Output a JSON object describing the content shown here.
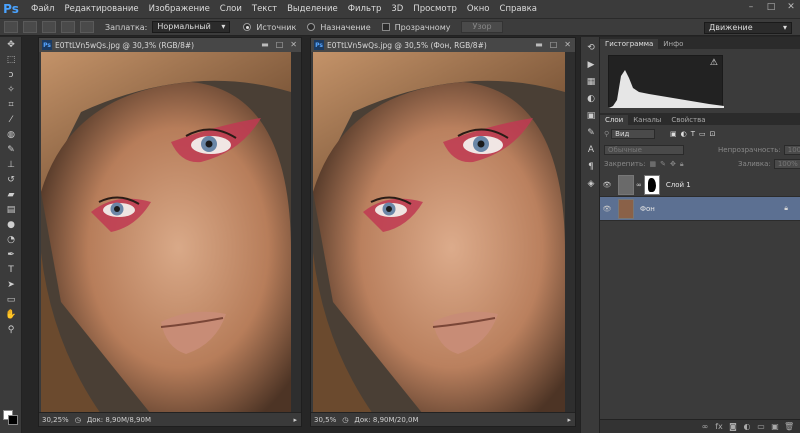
{
  "app": {
    "logo": "Ps"
  },
  "menu": [
    "Файл",
    "Редактирование",
    "Изображение",
    "Слои",
    "Текст",
    "Выделение",
    "Фильтр",
    "3D",
    "Просмотр",
    "Окно",
    "Справка"
  ],
  "options": {
    "patch_label": "Заплатка:",
    "patch_mode": "Нормальный",
    "source_label": "Источник",
    "dest_label": "Назначение",
    "transparent_label": "Прозрачному",
    "pattern_button": "Узор",
    "workspace": "Движение"
  },
  "documents": [
    {
      "title": "E0TtLVn5wQs.jpg @ 30,3% (RGB/8#)",
      "zoom": "30,25%",
      "doc_size": "Док: 8,90M/8,90M"
    },
    {
      "title": "E0TtLVn5wQs.jpg @ 30,5% (Фон, RGB/8#)",
      "zoom": "30,5%",
      "doc_size": "Док: 8,90M/20,0M"
    }
  ],
  "panels": {
    "top_tabs": [
      "Гистограмма",
      "Инфо"
    ],
    "layer_tabs": [
      "Слои",
      "Каналы",
      "Свойства"
    ],
    "kind_filter": "Вид",
    "blend_mode": "Обычные",
    "opacity_label": "Непрозрачность:",
    "opacity_value": "100%",
    "lock_label": "Закрепить:",
    "fill_label": "Заливка:",
    "fill_value": "100%",
    "layers": [
      {
        "name": "Слой 1",
        "selected": false
      },
      {
        "name": "Фон",
        "selected": true
      }
    ]
  },
  "colors": {
    "accent": "#4aa3ff",
    "selected_layer": "#5c7092",
    "panel_bg": "#3b3b3b"
  }
}
